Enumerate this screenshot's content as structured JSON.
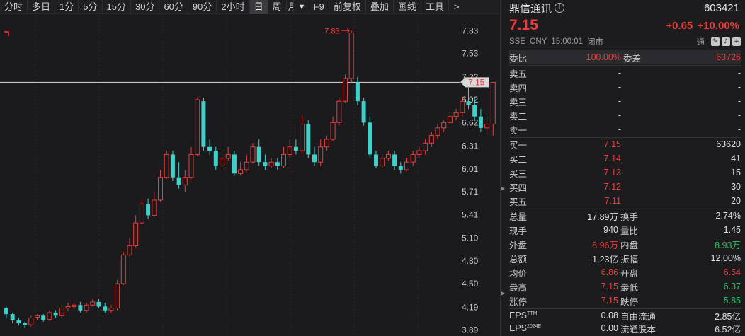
{
  "toolbar": {
    "items": [
      "分时",
      "多日",
      "1分",
      "5分",
      "15分",
      "30分",
      "60分",
      "90分",
      "2小时",
      "日",
      "周",
      "月"
    ],
    "active": "日",
    "more": [
      "F9",
      "前复权",
      "叠加",
      "画线",
      "工具"
    ],
    "next_arrow": ">"
  },
  "chart": {
    "price_labels": [
      "7.83",
      "7.53",
      "7.22",
      "6.92",
      "6.62",
      "6.31",
      "6.01",
      "5.71",
      "5.41",
      "5.10",
      "4.80",
      "4.50",
      "4.19",
      "3.89"
    ],
    "high_marker": "7.83",
    "current_price_tag": "7.15",
    "colors": {
      "up": "#ee3b3b",
      "down": "#3fd1c9",
      "bg": "#1b1b1e",
      "grid": "#2a2a2e"
    }
  },
  "chart_data": {
    "type": "candlestick",
    "ylim": [
      3.85,
      8.0
    ],
    "x": [
      "c1",
      "c2",
      "c3",
      "c4",
      "c5",
      "c6",
      "c7",
      "c8",
      "c9",
      "c10",
      "c11",
      "c12",
      "c13",
      "c14",
      "c15",
      "c16",
      "c17",
      "c18",
      "c19",
      "c20",
      "c21",
      "c22",
      "c23",
      "c24",
      "c25",
      "c26",
      "c27",
      "c28",
      "c29",
      "c30",
      "c31",
      "c32",
      "c33",
      "c34",
      "c35",
      "c36",
      "c37",
      "c38",
      "c39",
      "c40",
      "c41",
      "c42",
      "c43",
      "c44",
      "c45",
      "c46",
      "c47",
      "c48",
      "c49",
      "c50",
      "c51",
      "c52",
      "c53",
      "c54",
      "c55",
      "c56",
      "c57",
      "c58",
      "c59",
      "c60",
      "c61",
      "c62",
      "c63",
      "c64",
      "c65",
      "c66",
      "c67",
      "c68",
      "c69",
      "c70",
      "c71",
      "c72",
      "c73",
      "c74",
      "c75",
      "c76",
      "c77",
      "c78",
      "c79",
      "c80"
    ],
    "open": [
      4.18,
      4.1,
      4.02,
      3.98,
      3.96,
      4.06,
      4.08,
      4.03,
      4.12,
      4.08,
      4.18,
      4.2,
      4.22,
      4.15,
      4.22,
      4.26,
      4.2,
      4.15,
      4.18,
      4.5,
      4.88,
      5.0,
      5.3,
      5.55,
      5.4,
      5.6,
      5.9,
      6.2,
      5.9,
      5.8,
      5.9,
      6.2,
      6.9,
      6.3,
      6.25,
      6.05,
      6.15,
      6.2,
      5.95,
      6.0,
      6.1,
      6.3,
      6.1,
      6.05,
      6.1,
      6.05,
      6.2,
      6.3,
      6.25,
      6.6,
      6.2,
      6.1,
      6.3,
      6.4,
      6.62,
      6.9,
      7.2,
      7.15,
      6.9,
      6.62,
      6.2,
      6.05,
      6.15,
      6.2,
      6.05,
      6.0,
      6.1,
      6.2,
      6.25,
      6.35,
      6.45,
      6.55,
      6.62,
      6.7,
      6.75,
      6.9,
      6.85,
      6.7,
      6.55,
      6.6
    ],
    "close": [
      4.1,
      4.02,
      3.98,
      3.96,
      4.05,
      4.08,
      4.02,
      4.12,
      4.08,
      4.18,
      4.2,
      4.22,
      4.15,
      4.22,
      4.26,
      4.2,
      4.15,
      4.18,
      4.5,
      4.88,
      5.0,
      5.3,
      5.55,
      5.4,
      5.6,
      5.9,
      6.2,
      5.9,
      5.8,
      5.9,
      6.2,
      6.92,
      6.3,
      6.25,
      6.05,
      6.15,
      6.2,
      5.95,
      6.0,
      6.1,
      6.3,
      6.1,
      6.05,
      6.1,
      6.05,
      6.2,
      6.3,
      6.25,
      6.6,
      6.2,
      6.1,
      6.3,
      6.4,
      6.62,
      6.9,
      7.2,
      7.8,
      6.9,
      6.62,
      6.2,
      6.05,
      6.15,
      6.2,
      6.05,
      6.0,
      6.1,
      6.2,
      6.25,
      6.35,
      6.45,
      6.55,
      6.62,
      6.7,
      6.75,
      6.9,
      6.85,
      6.7,
      6.55,
      6.6,
      7.15
    ],
    "high": [
      4.2,
      4.12,
      4.05,
      4.0,
      4.08,
      4.1,
      4.1,
      4.15,
      4.15,
      4.22,
      4.25,
      4.25,
      4.26,
      4.25,
      4.3,
      4.3,
      4.25,
      4.22,
      4.55,
      4.92,
      5.1,
      5.4,
      5.6,
      5.62,
      5.7,
      6.0,
      6.25,
      6.25,
      6.1,
      6.0,
      6.3,
      6.95,
      6.95,
      6.4,
      6.3,
      6.25,
      6.3,
      6.25,
      6.1,
      6.2,
      6.35,
      6.4,
      6.2,
      6.15,
      6.15,
      6.3,
      6.4,
      6.4,
      6.72,
      6.65,
      6.3,
      6.4,
      6.45,
      6.7,
      6.95,
      7.25,
      7.83,
      7.22,
      6.95,
      6.7,
      6.25,
      6.2,
      6.25,
      6.25,
      6.1,
      6.15,
      6.25,
      6.3,
      6.4,
      6.5,
      6.6,
      6.65,
      6.75,
      6.8,
      6.95,
      7.1,
      6.95,
      6.8,
      6.7,
      7.15
    ],
    "low": [
      4.05,
      3.98,
      3.95,
      3.92,
      3.94,
      4.02,
      4.0,
      4.01,
      4.05,
      4.05,
      4.15,
      4.17,
      4.12,
      4.12,
      4.2,
      4.18,
      4.12,
      4.12,
      4.15,
      4.48,
      4.85,
      4.98,
      5.28,
      5.35,
      5.38,
      5.58,
      5.88,
      5.85,
      5.75,
      5.7,
      5.88,
      6.18,
      6.25,
      6.2,
      6.0,
      6.02,
      6.12,
      5.92,
      5.92,
      5.98,
      6.08,
      6.05,
      6.0,
      6.02,
      6.0,
      6.02,
      6.15,
      6.2,
      6.2,
      6.15,
      6.05,
      6.05,
      6.25,
      6.38,
      6.58,
      6.88,
      7.15,
      6.85,
      6.58,
      6.15,
      6.02,
      6.02,
      6.12,
      6.0,
      5.95,
      5.98,
      6.05,
      6.15,
      6.2,
      6.3,
      6.4,
      6.5,
      6.58,
      6.65,
      6.7,
      6.8,
      6.65,
      6.5,
      6.45,
      6.45
    ]
  },
  "panel": {
    "name": "鼎信通讯",
    "code": "603421",
    "price": "7.15",
    "change": "+0.65",
    "change_pct": "+10.00%",
    "exchange": "SSE",
    "currency": "CNY",
    "time": "15:00:01",
    "status": "闭市",
    "tong": "通",
    "weibi_label": "委比",
    "weibi_value": "100.00%",
    "weicha_label": "委差",
    "weicha_value": "63726",
    "asks": [
      {
        "label": "卖五",
        "price": "-",
        "vol": "-"
      },
      {
        "label": "卖四",
        "price": "-",
        "vol": "-"
      },
      {
        "label": "卖三",
        "price": "-",
        "vol": "-"
      },
      {
        "label": "卖二",
        "price": "-",
        "vol": "-"
      },
      {
        "label": "卖一",
        "price": "-",
        "vol": "-"
      }
    ],
    "bids": [
      {
        "label": "买一",
        "price": "7.15",
        "vol": "63620"
      },
      {
        "label": "买二",
        "price": "7.14",
        "vol": "41"
      },
      {
        "label": "买三",
        "price": "7.13",
        "vol": "15"
      },
      {
        "label": "买四",
        "price": "7.12",
        "vol": "30"
      },
      {
        "label": "买五",
        "price": "7.11",
        "vol": "20"
      }
    ],
    "stats": [
      {
        "l1": "总量",
        "v1": "17.89万",
        "c1": "white",
        "l2": "换手",
        "v2": "2.74%",
        "c2": "white"
      },
      {
        "l1": "现手",
        "v1": "940",
        "c1": "white",
        "l2": "量比",
        "v2": "1.45",
        "c2": "white"
      },
      {
        "l1": "外盘",
        "v1": "8.96万",
        "c1": "red",
        "l2": "内盘",
        "v2": "8.93万",
        "c2": "green"
      },
      {
        "l1": "总额",
        "v1": "1.23亿",
        "c1": "white",
        "l2": "振幅",
        "v2": "12.00%",
        "c2": "white"
      },
      {
        "l1": "均价",
        "v1": "6.86",
        "c1": "red",
        "l2": "开盘",
        "v2": "6.54",
        "c2": "red"
      },
      {
        "l1": "最高",
        "v1": "7.15",
        "c1": "red",
        "l2": "最低",
        "v2": "6.37",
        "c2": "green"
      },
      {
        "l1": "涨停",
        "v1": "7.15",
        "c1": "red",
        "l2": "跌停",
        "v2": "5.85",
        "c2": "green"
      }
    ],
    "eps": [
      {
        "l1": "EPS",
        "sup": "TTM",
        "v1": "0.08",
        "l2": "自由流通",
        "v2": "2.85亿"
      },
      {
        "l1": "EPS",
        "sup": "2024E",
        "v1": "0.00",
        "l2": "流通股本",
        "v2": "6.52亿"
      }
    ]
  }
}
